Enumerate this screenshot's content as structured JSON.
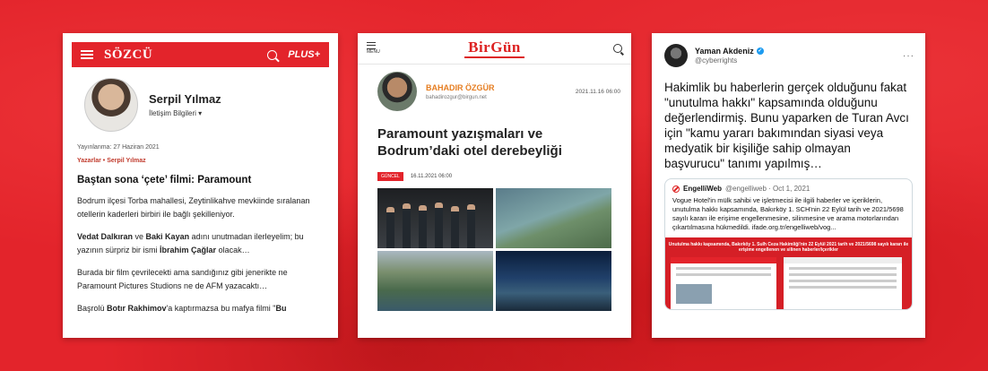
{
  "colors": {
    "background": "#e3242b",
    "sozcu_red": "#e3242b",
    "birgun_red": "#d22",
    "author_orange": "#e67e22",
    "twitter_blue": "#1d9bf0"
  },
  "sozcu": {
    "logo": "SÖZCÜ",
    "plus_label": "PLUS+",
    "author_name": "Serpil Yılmaz",
    "contact_label": "İletişim Bilgileri ▾",
    "published": "Yayınlanma: 27 Haziran 2021",
    "breadcrumb": "Yazarlar • Serpil Yılmaz",
    "title": "Baştan sona ‘çete’ filmi: Paramount",
    "p1": "Bodrum ilçesi Torba mahallesi, Zeytinlikahve mevkiinde sıralanan otellerin kaderleri birbiri ile bağlı şekilleniyor.",
    "p2_bold1": "Vedat Dalkıran",
    "p2_mid1": " ve ",
    "p2_bold2": "Baki Kayan",
    "p2_mid2": " adını unutmadan ilerleyelim; bu yazının sürpriz bir ismi ",
    "p2_bold3": "İbrahim Çağlar",
    "p2_end": " olacak…",
    "p3": "Burada bir film çevrilecekti ama sandığınız gibi jenerikte ne Paramount Pictures Studions ne de AFM yazacaktı…",
    "p4_start": "Başrolü ",
    "p4_bold1": "Botır Rakhimov",
    "p4_mid": "'a kaptırmazsa bu mafya filmi \"",
    "p4_bold2": "Bu"
  },
  "birgun": {
    "menu_label": "MENU",
    "logo": "BirGün",
    "author_name": "BAHADIR ÖZGÜR",
    "author_email": "bahadirozgur@birgun.net",
    "date_top": "2021.11.16 06:00",
    "title": "Paramount yazışmaları ve Bodrum’daki otel derebeyliği",
    "tag": "GÜNCEL",
    "date_bottom": "16.11.2021 06:00"
  },
  "tweet": {
    "name": "Yaman Akdeniz",
    "handle": "@cyberrights",
    "more": "···",
    "text": "Hakimlik bu haberlerin gerçek olduğunu fakat \"unutulma hakkı\" kapsamında olduğunu değerlendirmiş. Bunu yaparken de Turan Avcı için \"kamu yararı bakımından siyasi veya medyatik bir kişiliğe sahip olmayan başvurucu\" tanımı yapılmış…",
    "quote_name": "EngelliWeb",
    "quote_handle": "@engelliweb · Oct 1, 2021",
    "quote_text": "Vogue Hotel'in mülk sahibi ve işletmecisi ile ilgili haberler ve içeriklerin, unutulma hakkı kapsamında, Bakırköy 1. SCH'nin 22 Eylül tarih ve 2021/5698 sayılı kararı ile erişime engellenmesine, silinmesine ve arama motorlarından çıkartılmasına hükmedildi. ifade.org.tr/engelliweb/vog...",
    "image_caption": "Unutulma hakkı kapsamında, Bakırköy 1. Sulh Ceza Hakimliği'nin 22 Eylül 2021 tarih ve 2021/5698 sayılı kararı ile erişime engellenen ve silinen haberler/içerikler"
  }
}
